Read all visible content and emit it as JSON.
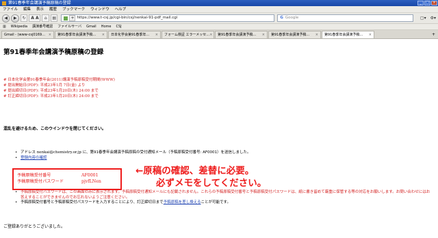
{
  "window": {
    "title": "第91春季年会講演予稿原稿の登録"
  },
  "menu": [
    "ファイル",
    "編集",
    "表示",
    "履歴",
    "ブックマーク",
    "ウィンドウ",
    "ヘルプ"
  ],
  "nav": {
    "url": "https://www.t-csj.jp/cgi-bin/csj/nenkai-91-pdf_mail.cgi",
    "search_placeholder": "Google"
  },
  "bookmarks": [
    "Wikipedia",
    "講演番号確認",
    "ファイルサーバ",
    "Gmail",
    "Home",
    "CSJ"
  ],
  "tabs": [
    "Gmail - (www-csj0169…",
    "第91春季年会講演予稿…",
    "日本化学会第91春季年…",
    "フォーム検証 エラーメッセ…",
    "第91春季年会講演予稿…",
    "第91春季年会講演予稿…",
    "第91春季年会講演予稿…"
  ],
  "page": {
    "title": "第91春季年会講演予稿原稿の登録",
    "red_notes": [
      "# 日本化学会第91春季年会(2011)講演予稿原稿受付期間(WWW)",
      "# 提出開始日(PDF): 平成23年1月 7日(金) より",
      "# 提出締切日(PDF): 平成23年1月20日(木) 24:00 まで",
      "# 訂正締切日(PDF): 平成23年1月20日(木) 24:00 まで"
    ],
    "notice": "混乱を避けるため、このウインドウを閉じてください。",
    "mail_prefix": "アドレス",
    "mail_address": "nenkai@chemistry.or.jp",
    "mail_suffix": "に、第91春季年会講演予稿原稿の受付通知メール（予稿原稿受付番号: AF0001）を送信しました。",
    "confirm_link": "登録内容の確認",
    "id_label": "予稿原稿受付番号",
    "id_value": "AF0001",
    "pw_label": "予稿原稿受付パスワード",
    "pw_value": "pjvfLNen",
    "warning_text": "予稿原稿受付パスワードは、この画面のみに表示されます。予稿原稿受付通知メールにも記載されません。これらの予稿原稿受付番号と予稿原稿受付パスワードは、紙に書き留めて厳重に保管する等の対応をお願いします。お問い合わせにはお答えすることができませんのでお忘れないようご注意ください。",
    "replace_prefix": "予稿原稿受付番号と予稿原稿受付パスワードを入力することにより、訂正締切日まで",
    "replace_link": "予稿原稿を差し換える",
    "replace_suffix": "ことが可能です。",
    "thanks": "ご登録ありがとうございました。",
    "annotation_line1": "←原稿の確認、差替に必要。",
    "annotation_line2": "必ずメモをしてください。"
  }
}
